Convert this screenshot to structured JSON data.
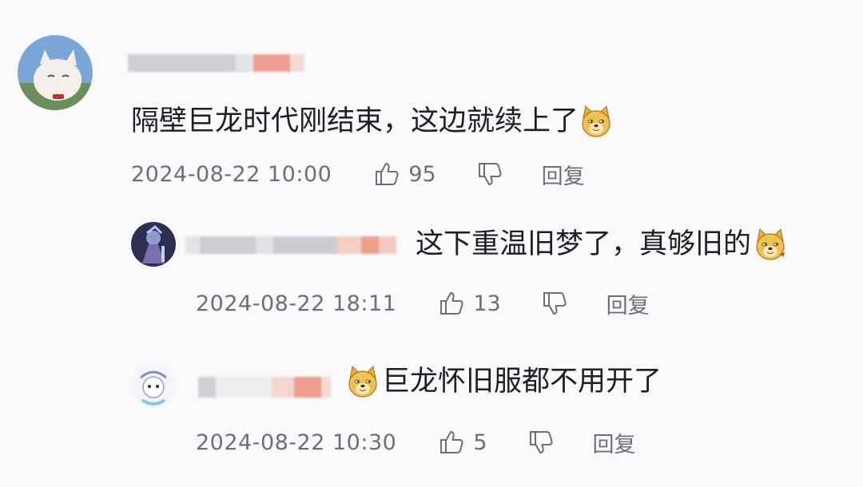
{
  "comments": [
    {
      "text": "隔壁巨龙时代刚结束，这边就续上了",
      "emoji": "doge-icon",
      "time": "2024-08-22 10:00",
      "likes": "95",
      "reply_label": "回复"
    },
    {
      "text": "这下重温旧梦了，真够旧的",
      "emoji": "doge-icon",
      "time": "2024-08-22 18:11",
      "likes": "13",
      "reply_label": "回复"
    },
    {
      "text": "巨龙怀旧服都不用开了",
      "emoji": "doge-icon",
      "time": "2024-08-22 10:30",
      "likes": "5",
      "reply_label": "回复"
    }
  ],
  "colors": {
    "background": "#fafafc",
    "meta_text": "#6e6e78",
    "blur_gray": "#c9c9cf",
    "blur_pink": "#f0a196"
  }
}
